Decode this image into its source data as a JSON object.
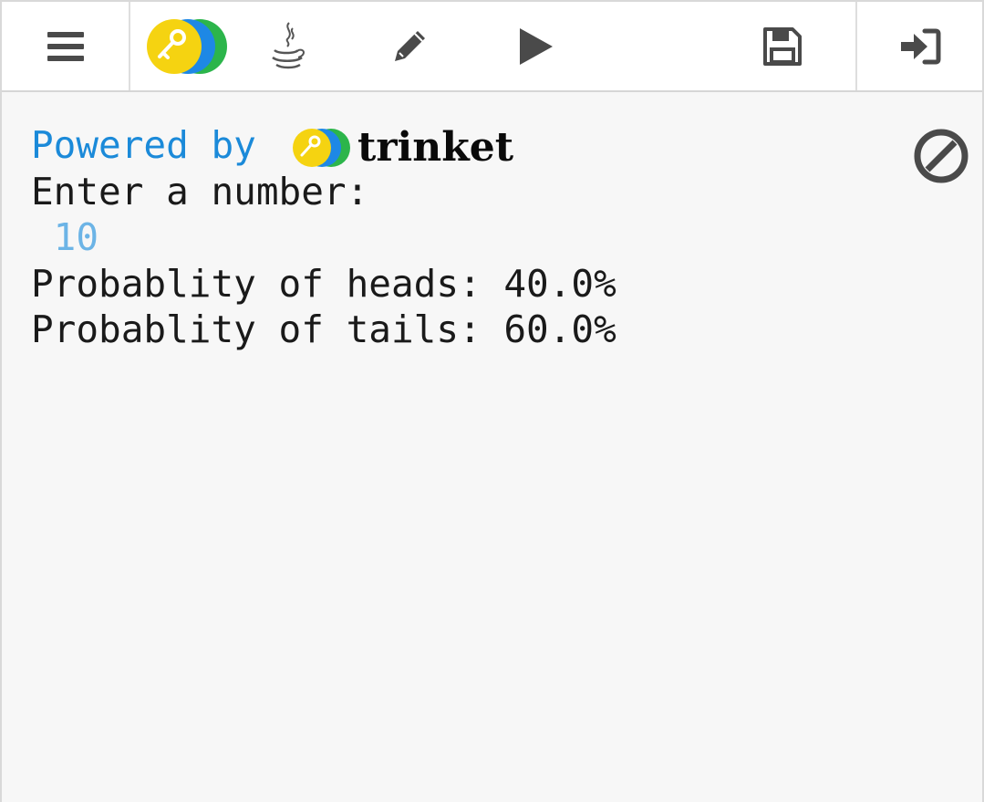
{
  "toolbar": {
    "menu_icon": "hamburger-menu-icon",
    "logo_icon": "trinket-logo-icon",
    "java_icon": "java-icon",
    "edit_icon": "pencil-icon",
    "run_icon": "play-icon",
    "save_icon": "save-icon",
    "login_icon": "sign-in-icon"
  },
  "console": {
    "powered_by": "Powered by",
    "brand": "trinket",
    "prompt": "Enter a number:",
    "input_value": " 10",
    "heads_line": "Probablity of heads: 40.0%",
    "tails_line": "Probablity of tails: 60.0%",
    "stop_icon": "stop-icon"
  },
  "colors": {
    "powered_by": "#1b8ad9",
    "input_value": "#6cb4e6",
    "logo_yellow": "#f5d311",
    "logo_blue": "#1e88e5",
    "logo_green": "#2cb54b",
    "icon_gray": "#4a4a4a"
  }
}
